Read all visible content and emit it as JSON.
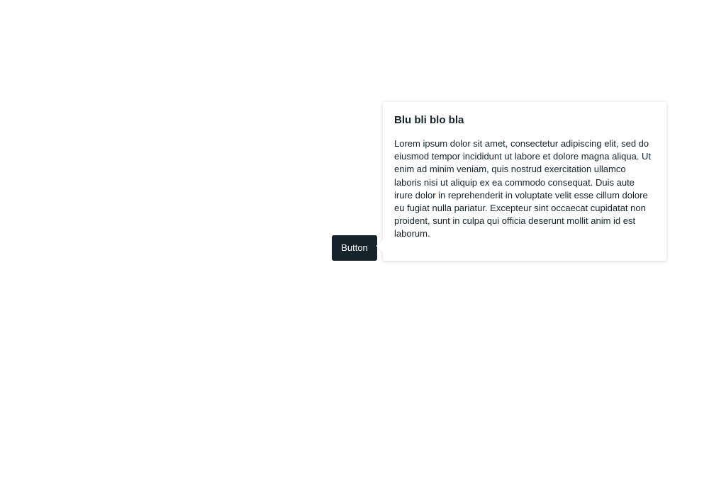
{
  "trigger": {
    "label": "Button"
  },
  "popover": {
    "title": "Blu bli blo bla",
    "body": "Lorem ipsum dolor sit amet, consectetur adipiscing elit, sed do eiusmod tempor incididunt ut labore et dolore magna aliqua. Ut enim ad minim veniam, quis nostrud exercitation ullamco laboris nisi ut aliquip ex ea commodo consequat. Duis aute irure dolor in reprehenderit in voluptate velit esse cillum dolore eu fugiat nulla pariatur. Excepteur sint occaecat cupidatat non proident, sunt in culpa qui officia deserunt mollit anim id est laborum."
  },
  "colors": {
    "button_background": "#16232a",
    "button_text": "#ffffff",
    "popover_background": "#ffffff",
    "text": "#16232a",
    "page_background": "#ffffff"
  }
}
